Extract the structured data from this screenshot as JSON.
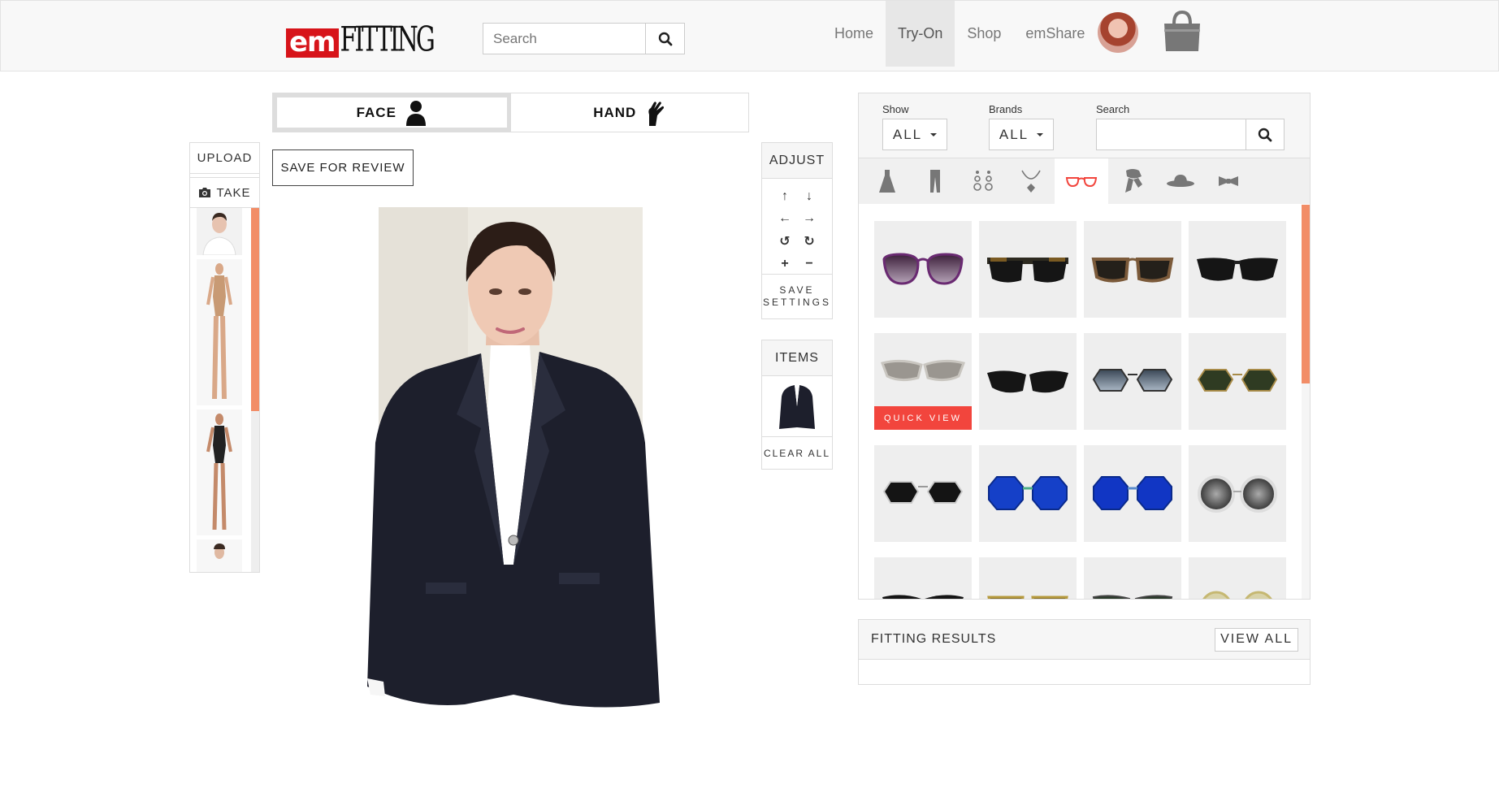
{
  "brand": {
    "logo_em": "em",
    "logo_fitting": "FITTING"
  },
  "header": {
    "search_placeholder": "Search",
    "nav": [
      {
        "label": "Home",
        "active": false
      },
      {
        "label": "Try-On",
        "active": true
      },
      {
        "label": "Shop",
        "active": false
      },
      {
        "label": "emShare",
        "active": false
      }
    ]
  },
  "mode_tabs": [
    {
      "label": "FACE",
      "active": true,
      "icon": "person-silhouette-icon"
    },
    {
      "label": "HAND",
      "active": false,
      "icon": "hand-icon"
    }
  ],
  "save_for_review_label": "SAVE FOR REVIEW",
  "left_panel": {
    "upload_label": "UPLOAD",
    "take_label": "TAKE",
    "take_icon": "camera-icon",
    "scroll_fraction": 0.55
  },
  "adjust": {
    "title": "ADJUST",
    "controls": [
      "↑",
      "↓",
      "←",
      "→",
      "↺",
      "↻",
      "+",
      "−"
    ],
    "save_settings_label": "SAVE SETTINGS"
  },
  "items_panel": {
    "title": "ITEMS",
    "clear_all_label": "CLEAR ALL"
  },
  "filters": {
    "show_label": "Show",
    "show_value": "ALL",
    "brands_label": "Brands",
    "brands_value": "ALL",
    "search_label": "Search",
    "search_value": ""
  },
  "categories": [
    {
      "icon": "dress-icon",
      "active": false
    },
    {
      "icon": "pants-icon",
      "active": false
    },
    {
      "icon": "earrings-icon",
      "active": false
    },
    {
      "icon": "necklace-icon",
      "active": false
    },
    {
      "icon": "glasses-icon",
      "active": true
    },
    {
      "icon": "scarf-icon",
      "active": false
    },
    {
      "icon": "hat-icon",
      "active": false
    },
    {
      "icon": "bowtie-icon",
      "active": false
    }
  ],
  "quick_view_label": "QUICK VIEW",
  "fitting_results": {
    "title": "FITTING RESULTS",
    "view_all_label": "VIEW ALL"
  },
  "colors": {
    "accent": "#f28d67",
    "quick_view": "#f2453d",
    "logo_red": "#d7141a"
  }
}
